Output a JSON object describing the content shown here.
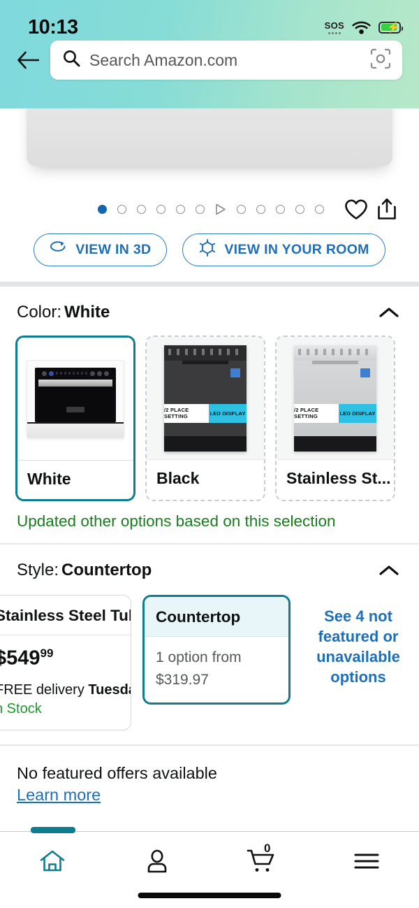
{
  "status_bar": {
    "time": "10:13",
    "sos_label": "SOS",
    "wifi_icon": "wifi-icon",
    "battery_icon": "battery-charging-icon",
    "battery_color": "#37d13f"
  },
  "header": {
    "back_icon": "back-arrow-icon",
    "search_icon": "search-icon",
    "search_value": "",
    "search_placeholder": "Search Amazon.com",
    "camera_icon": "camera-scan-icon",
    "gradient_from": "#7fd9dd",
    "gradient_to": "#b6e8c8"
  },
  "gallery": {
    "dot_count": 12,
    "active_index": 0,
    "video_index": 6,
    "active_dot_color": "#1266ac",
    "favorite_icon": "heart-icon",
    "share_icon": "share-icon",
    "buttons": [
      {
        "label": "VIEW IN 3D",
        "icon": "rotate-3d-icon"
      },
      {
        "label": "VIEW IN YOUR ROOM",
        "icon": "ar-cube-icon"
      }
    ],
    "button_color": "#1f6fb8"
  },
  "color_section": {
    "label": "Color:",
    "value": "White",
    "collapse_icon": "chevron-up-icon",
    "selected_border_color": "#0e7d8f",
    "options": [
      {
        "name": "White",
        "label": "White",
        "selected": true,
        "art": "white"
      },
      {
        "name": "Black",
        "label": "Black",
        "selected": false,
        "art": "dark"
      },
      {
        "name": "Stainless Steel",
        "label": "Stainless St...",
        "selected": false,
        "art": "steel"
      }
    ],
    "product_art_labels": {
      "place_setting": "/2 PLACE SETTING",
      "led_display": "LED DISPLAY"
    },
    "update_note": "Updated other options based on this selection",
    "update_note_color": "#197c1e"
  },
  "style_section": {
    "label": "Style:",
    "value": "Countertop",
    "collapse_icon": "chevron-up-icon",
    "options": [
      {
        "title": "Stainless Steel Tub",
        "price_main": "549",
        "price_cents": "99",
        "delivery_prefix": "FREE delivery ",
        "delivery_day": "Tuesday",
        "stock": "n Stock",
        "selected": false,
        "partial": true
      },
      {
        "title": "Countertop",
        "sub_line1": "1 option from",
        "sub_line2": "$319.97",
        "selected": true,
        "partial": false
      }
    ],
    "see_more_link": "See 4 not featured or unavailable options"
  },
  "offers": {
    "title": "No featured offers available",
    "link": "Learn more"
  },
  "bottom_nav": {
    "active_color": "#0e7d8f",
    "items": [
      {
        "name": "home",
        "icon": "home-icon",
        "active": true
      },
      {
        "name": "account",
        "icon": "person-icon",
        "active": false
      },
      {
        "name": "cart",
        "icon": "cart-icon",
        "active": false,
        "badge": "0"
      },
      {
        "name": "menu",
        "icon": "hamburger-menu-icon",
        "active": false
      }
    ]
  }
}
